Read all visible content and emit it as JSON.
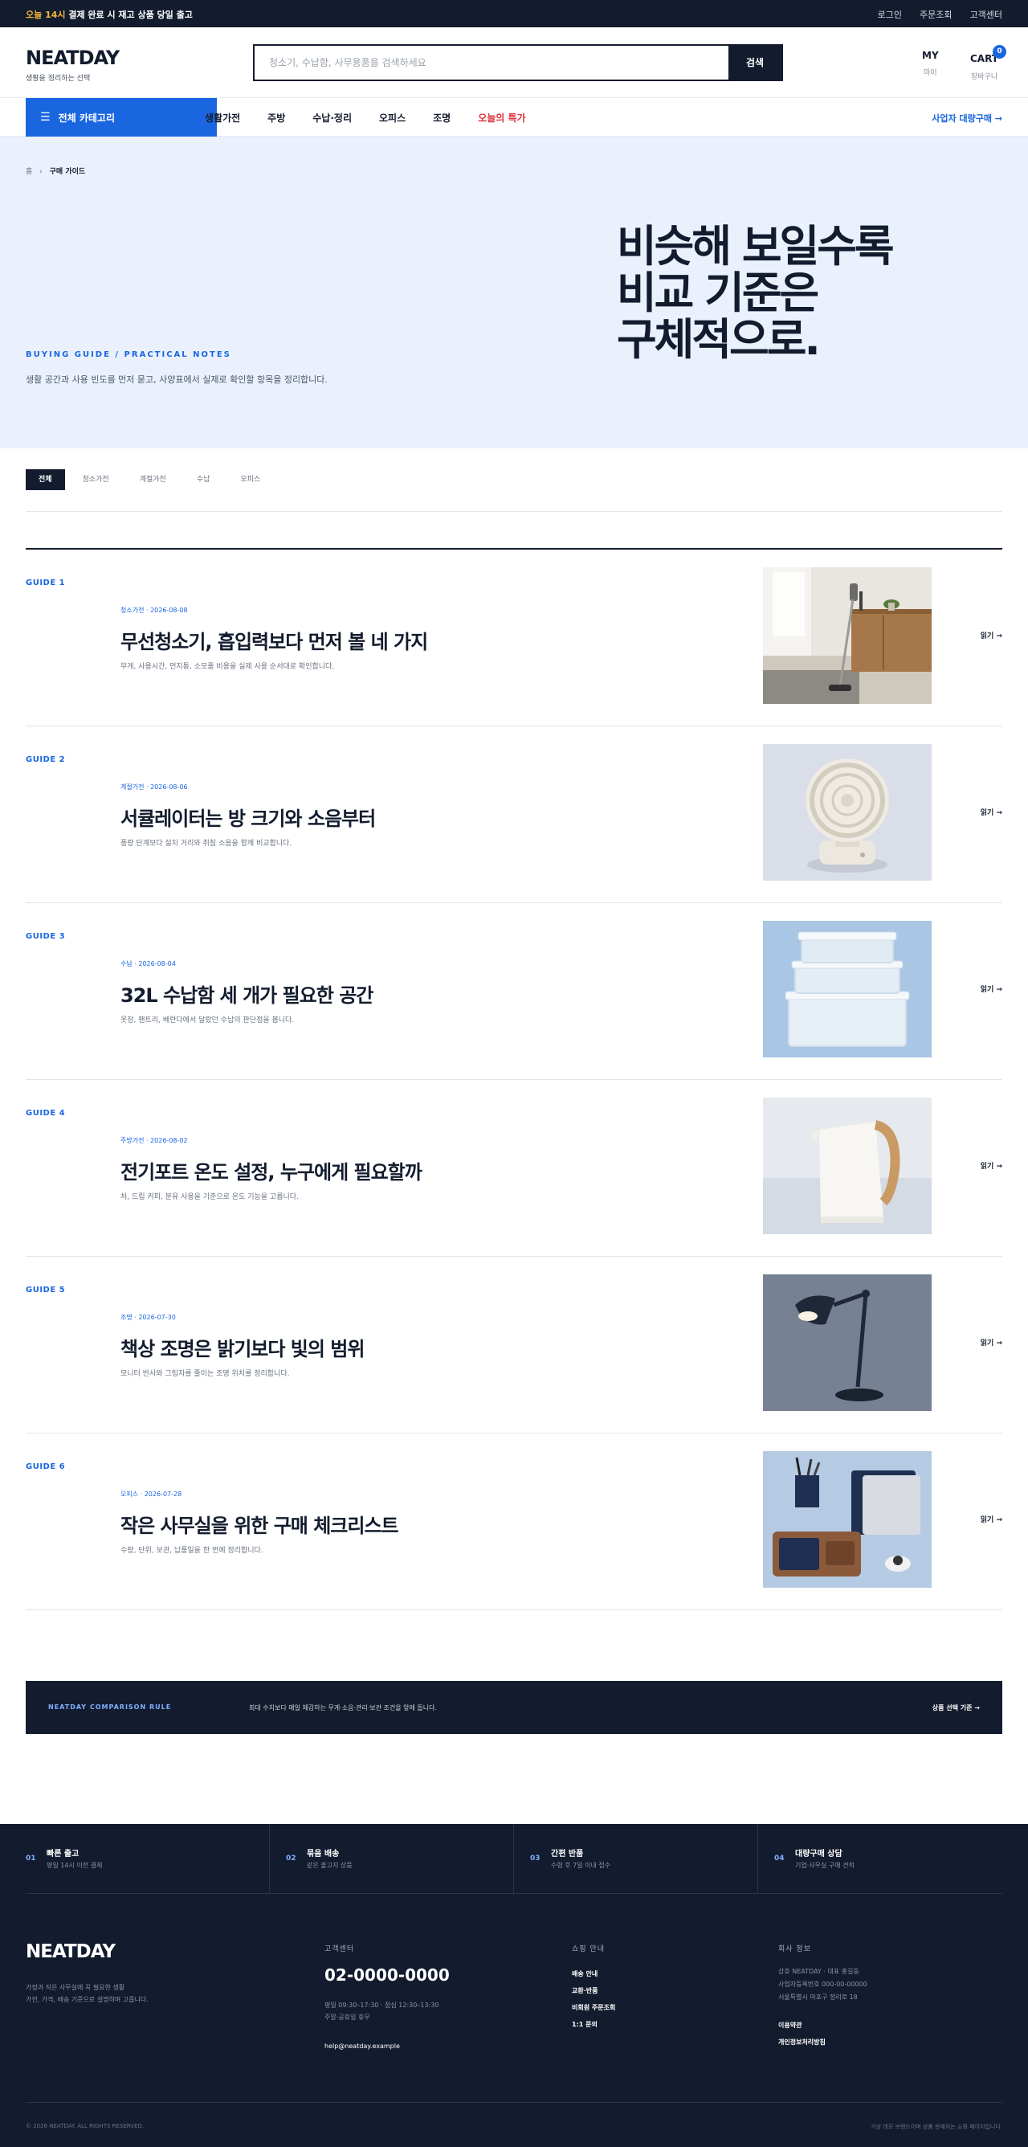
{
  "topbar": {
    "promo_highlight": "오늘 14시",
    "promo_rest": " 결제 완료 시 재고 상품 당일 출고",
    "links": [
      "로그인",
      "주문조회",
      "고객센터"
    ]
  },
  "header": {
    "logo": "NEATDAY",
    "tagline": "생활을 정리하는 선택",
    "search_placeholder": "청소기, 수납함, 사무용품을 검색하세요",
    "search_button": "검색",
    "my_label": "MY",
    "my_sub": "마이",
    "cart_label": "CART",
    "cart_sub": "장바구니",
    "cart_count": "0"
  },
  "nav": {
    "all_categories": "전체 카테고리",
    "items": [
      "생활가전",
      "주방",
      "수납·정리",
      "오피스",
      "조명"
    ],
    "deal": "오늘의 특가",
    "bulk_link": "사업자 대량구매 →"
  },
  "hero": {
    "breadcrumb_home": "홈",
    "breadcrumb_sep": "›",
    "breadcrumb_current": "구매 가이드",
    "eyebrow": "BUYING GUIDE / PRACTICAL NOTES",
    "description": "생활 공간과 사용 빈도를 먼저 묻고, 사양표에서 실제로 확인할 항목을 정리합니다.",
    "title": "비슷해 보일수록\n비교 기준은\n구체적으로."
  },
  "filters": [
    "전체",
    "청소가전",
    "계절가전",
    "수납",
    "오피스"
  ],
  "guides": [
    {
      "num": "GUIDE 1",
      "meta": "청소가전 · 2026-08-08",
      "title": "무선청소기, 흡입력보다 먼저 볼 네 가지",
      "desc": "무게, 사용시간, 먼지통, 소모품 비용을 실제 사용 순서대로 확인합니다.",
      "read": "읽기 →"
    },
    {
      "num": "GUIDE 2",
      "meta": "계절가전 · 2026-08-06",
      "title": "서큘레이터는 방 크기와 소음부터",
      "desc": "풍량 단계보다 설치 거리와 취침 소음을 함께 비교합니다.",
      "read": "읽기 →"
    },
    {
      "num": "GUIDE 3",
      "meta": "수납 · 2026-08-04",
      "title": "32L 수납함 세 개가 필요한 공간",
      "desc": "옷장, 팬트리, 베란다에서 달랐던 수납의 판단점을 봅니다.",
      "read": "읽기 →"
    },
    {
      "num": "GUIDE 4",
      "meta": "주방가전 · 2026-08-02",
      "title": "전기포트 온도 설정, 누구에게 필요할까",
      "desc": "차, 드립 커피, 분유 사용을 기준으로 온도 기능을 고릅니다.",
      "read": "읽기 →"
    },
    {
      "num": "GUIDE 5",
      "meta": "조명 · 2026-07-30",
      "title": "책상 조명은 밝기보다 빛의 범위",
      "desc": "모니터 반사와 그림자를 줄이는 조명 위치를 정리합니다.",
      "read": "읽기 →"
    },
    {
      "num": "GUIDE 6",
      "meta": "오피스 · 2026-07-28",
      "title": "작은 사무실을 위한 구매 체크리스트",
      "desc": "수량, 단위, 보관, 납품일을 한 번에 정리합니다.",
      "read": "읽기 →"
    }
  ],
  "strip": {
    "label": "NEATDAY COMPARISON RULE",
    "text": "최대 수치보다 매일 체감하는 무게·소음·관리·보관 조건을 앞에 둡니다.",
    "link": "상품 선택 기준 →"
  },
  "features": [
    {
      "num": "01",
      "title": "빠른 출고",
      "sub": "평일 14시 이전 결제"
    },
    {
      "num": "02",
      "title": "묶음 배송",
      "sub": "같은 출고지 상품"
    },
    {
      "num": "03",
      "title": "간편 반품",
      "sub": "수령 후 7일 이내 접수"
    },
    {
      "num": "04",
      "title": "대량구매 상담",
      "sub": "기업·사무실 구매 견적"
    }
  ],
  "footer": {
    "logo": "NEATDAY",
    "about": "가정과 작은 사무실에 꼭 필요한 생활\n가전, 가격, 배송 기준으로 설명하며 고릅니다.",
    "cs_head": "고객센터",
    "phone": "02-0000-0000",
    "hours": "평일 09:30–17:30 · 점심 12:30–13:30\n주말·공휴일 휴무",
    "email": "help@neatday.example",
    "shop_head": "쇼핑 안내",
    "shop_links": [
      "배송 안내",
      "교환·반품",
      "비회원 주문조회",
      "1:1 문의"
    ],
    "corp_head": "회사 정보",
    "corp_info": "상호 NEATDAY · 대표 홍길동\n사업자등록번호 000-00-00000\n서울특별시 마포구 정리로 18",
    "corp_links": [
      "이용약관",
      "개인정보처리방침"
    ],
    "copyright": "© 2026 NEATDAY. ALL RIGHTS RESERVED.",
    "disclaimer": "가상 데모 브랜드이며 상품 판매처는 쇼핑 페이지입니다."
  }
}
